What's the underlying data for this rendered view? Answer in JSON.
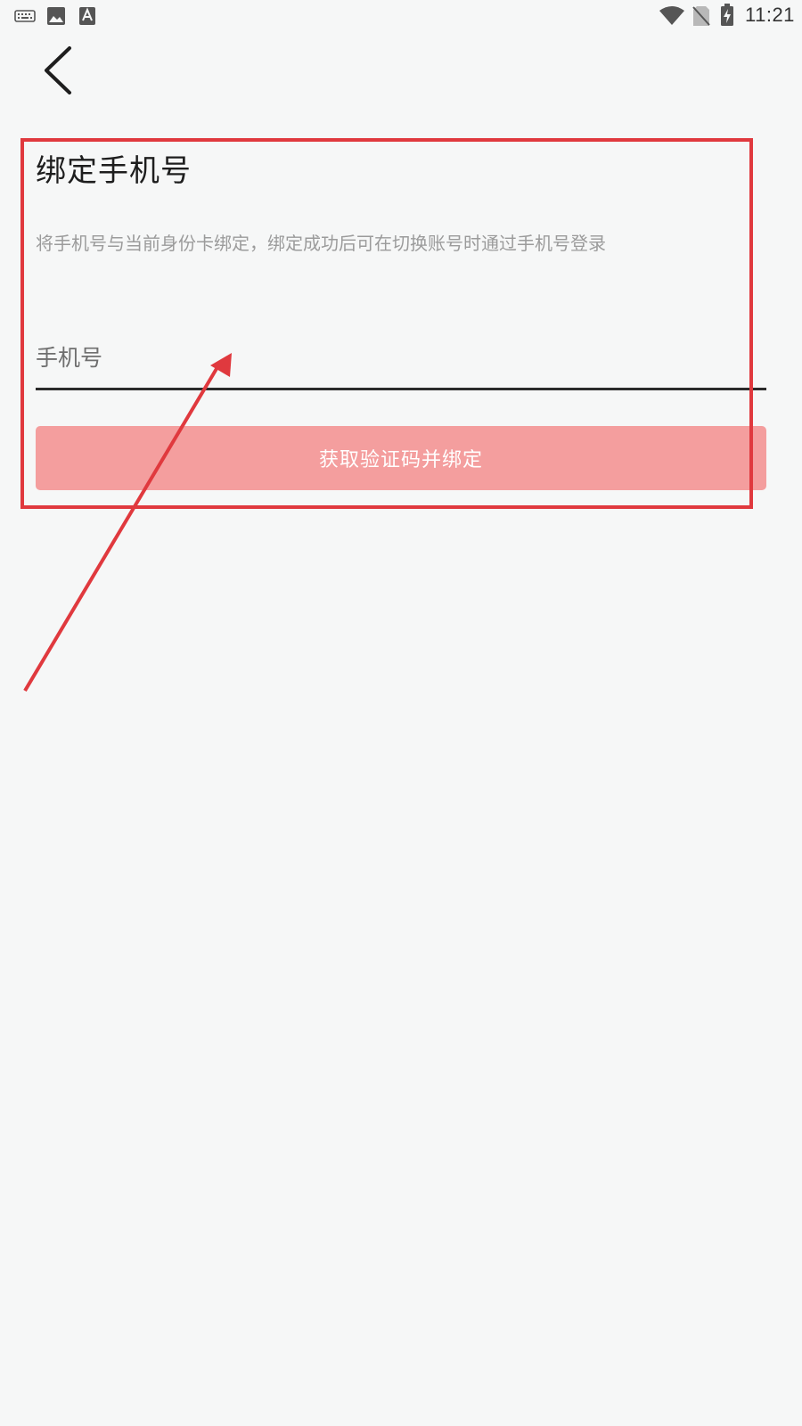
{
  "status_bar": {
    "left_icons": [
      "keyboard-icon",
      "image-icon",
      "text-a-icon"
    ],
    "right_icons": [
      "wifi-icon",
      "no-sim-icon",
      "battery-charging-icon"
    ],
    "time": "11:21"
  },
  "header": {
    "back_icon": "chevron-left-icon"
  },
  "main": {
    "title": "绑定手机号",
    "description": "将手机号与当前身份卡绑定，绑定成功后可在切换账号时通过手机号登录",
    "phone_input": {
      "placeholder": "手机号",
      "value": ""
    },
    "submit_label": "获取验证码并绑定"
  },
  "colors": {
    "button_background": "#f49e9e",
    "annotation": "#e0393e",
    "background": "#f6f7f7"
  }
}
